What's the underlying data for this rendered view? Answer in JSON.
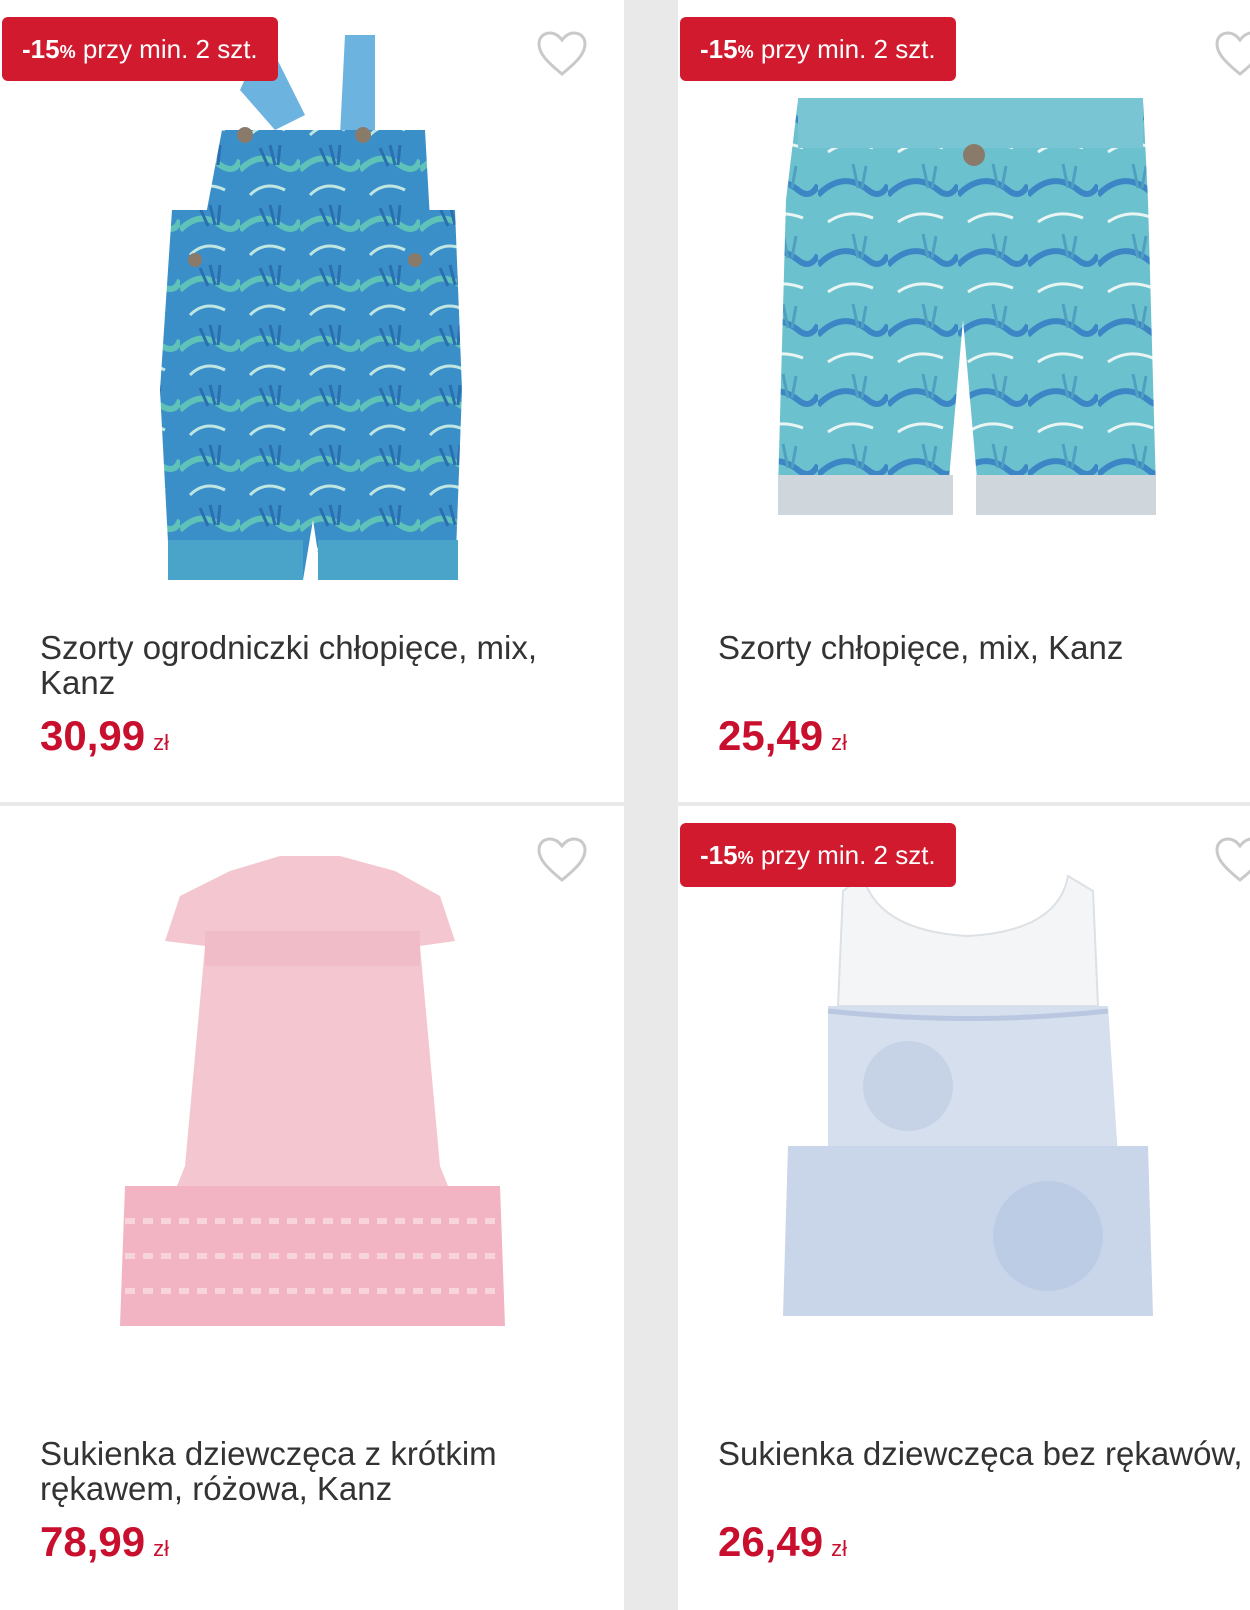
{
  "products": [
    {
      "name": "Szorty ogrodniczki chłopięce, mix, Kanz",
      "price": "30,99",
      "currency": "zł",
      "badge": {
        "percent": "-15",
        "percent_sign": "%",
        "text": "przy min. 2 szt."
      },
      "image": "overalls-tropical-print",
      "icon": "heart-icon"
    },
    {
      "name": "Szorty chłopięce, mix, Kanz",
      "price": "25,49",
      "currency": "zł",
      "badge": {
        "percent": "-15",
        "percent_sign": "%",
        "text": "przy min. 2 szt."
      },
      "image": "shorts-tropical-print",
      "icon": "heart-icon"
    },
    {
      "name": "Sukienka dziewczęca z krótkim rękawem, różowa, Kanz",
      "price": "78,99",
      "currency": "zł",
      "image": "pink-dress",
      "icon": "heart-icon"
    },
    {
      "name": "Sukienka dziewczęca bez rękawów, mix, Kanz",
      "price": "26,49",
      "currency": "zł",
      "badge": {
        "percent": "-15",
        "percent_sign": "%",
        "text": "przy min. 2 szt."
      },
      "image": "white-blue-dress",
      "icon": "heart-icon"
    }
  ],
  "colors": {
    "accent": "#d11a2e",
    "price": "#c8102e",
    "background": "#e9e9e9"
  }
}
